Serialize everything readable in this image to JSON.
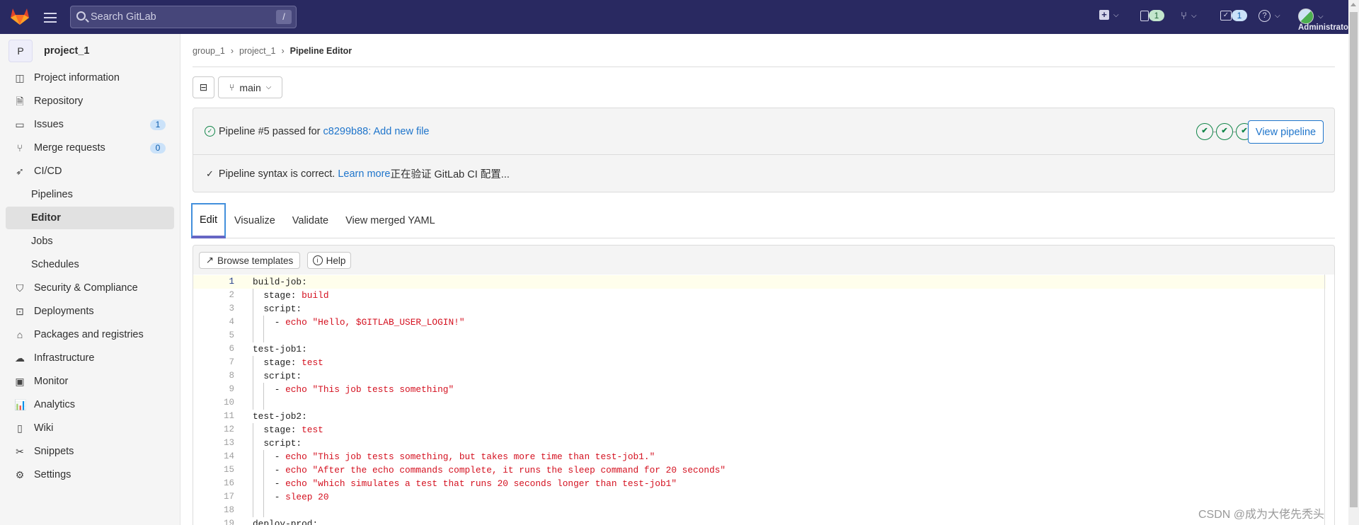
{
  "header": {
    "search_placeholder": "Search GitLab",
    "search_shortcut": "/",
    "issues_count": "1",
    "todos_count": "1",
    "user_label": "Administrator",
    "bg_color": "#292961"
  },
  "sidebar": {
    "project_initial": "P",
    "project_name": "project_1",
    "items": [
      {
        "label": "Project information",
        "icon": "project-icon"
      },
      {
        "label": "Repository",
        "icon": "document-icon"
      },
      {
        "label": "Issues",
        "icon": "issues-icon",
        "count": "1"
      },
      {
        "label": "Merge requests",
        "icon": "merge-request-icon",
        "count": "0"
      },
      {
        "label": "CI/CD",
        "icon": "rocket-icon"
      },
      {
        "label": "Pipelines",
        "sub": true
      },
      {
        "label": "Editor",
        "sub": true,
        "active": true
      },
      {
        "label": "Jobs",
        "sub": true
      },
      {
        "label": "Schedules",
        "sub": true
      },
      {
        "label": "Security & Compliance",
        "icon": "shield-icon"
      },
      {
        "label": "Deployments",
        "icon": "deployments-icon"
      },
      {
        "label": "Packages and registries",
        "icon": "package-icon"
      },
      {
        "label": "Infrastructure",
        "icon": "cloud-gear-icon"
      },
      {
        "label": "Monitor",
        "icon": "monitor-icon"
      },
      {
        "label": "Analytics",
        "icon": "chart-icon"
      },
      {
        "label": "Wiki",
        "icon": "book-icon"
      },
      {
        "label": "Snippets",
        "icon": "scissors-icon"
      },
      {
        "label": "Settings",
        "icon": "gear-icon"
      }
    ]
  },
  "breadcrumb": [
    "group_1",
    "project_1",
    "Pipeline Editor"
  ],
  "branch": "main",
  "pipeline": {
    "status_text": "Pipeline #5 passed for",
    "commit_link": "c8299b88: Add new file",
    "stages_passed": 3,
    "view_button": "View pipeline",
    "syntax_text": "Pipeline syntax is correct.",
    "learn_more": "Learn more",
    "validating_text": "正在验证 GitLab CI 配置..."
  },
  "tabs": [
    "Edit",
    "Visualize",
    "Validate",
    "View merged YAML"
  ],
  "toolbar": {
    "browse": "Browse templates",
    "help": "Help"
  },
  "code_lines": [
    [
      [
        "build-job:",
        ""
      ]
    ],
    [
      [
        "  stage: ",
        ""
      ],
      [
        "build",
        "str"
      ]
    ],
    [
      [
        "  script:",
        ""
      ]
    ],
    [
      [
        "    - ",
        ""
      ],
      [
        "echo \"Hello, $GITLAB_USER_LOGIN!\"",
        "str"
      ]
    ],
    [],
    [
      [
        "test-job1:",
        ""
      ]
    ],
    [
      [
        "  stage: ",
        ""
      ],
      [
        "test",
        "str"
      ]
    ],
    [
      [
        "  script:",
        ""
      ]
    ],
    [
      [
        "    - ",
        ""
      ],
      [
        "echo \"This job tests something\"",
        "str"
      ]
    ],
    [],
    [
      [
        "test-job2:",
        ""
      ]
    ],
    [
      [
        "  stage: ",
        ""
      ],
      [
        "test",
        "str"
      ]
    ],
    [
      [
        "  script:",
        ""
      ]
    ],
    [
      [
        "    - ",
        ""
      ],
      [
        "echo \"This job tests something, but takes more time than test-job1.\"",
        "str"
      ]
    ],
    [
      [
        "    - ",
        ""
      ],
      [
        "echo \"After the echo commands complete, it runs the sleep command for 20 seconds\"",
        "str"
      ]
    ],
    [
      [
        "    - ",
        ""
      ],
      [
        "echo \"which simulates a test that runs 20 seconds longer than test-job1\"",
        "str"
      ]
    ],
    [
      [
        "    - ",
        ""
      ],
      [
        "sleep 20",
        "str"
      ]
    ],
    [],
    [
      [
        "deploy-prod:",
        ""
      ]
    ]
  ],
  "watermark": "CSDN @成为大佬先秃头"
}
